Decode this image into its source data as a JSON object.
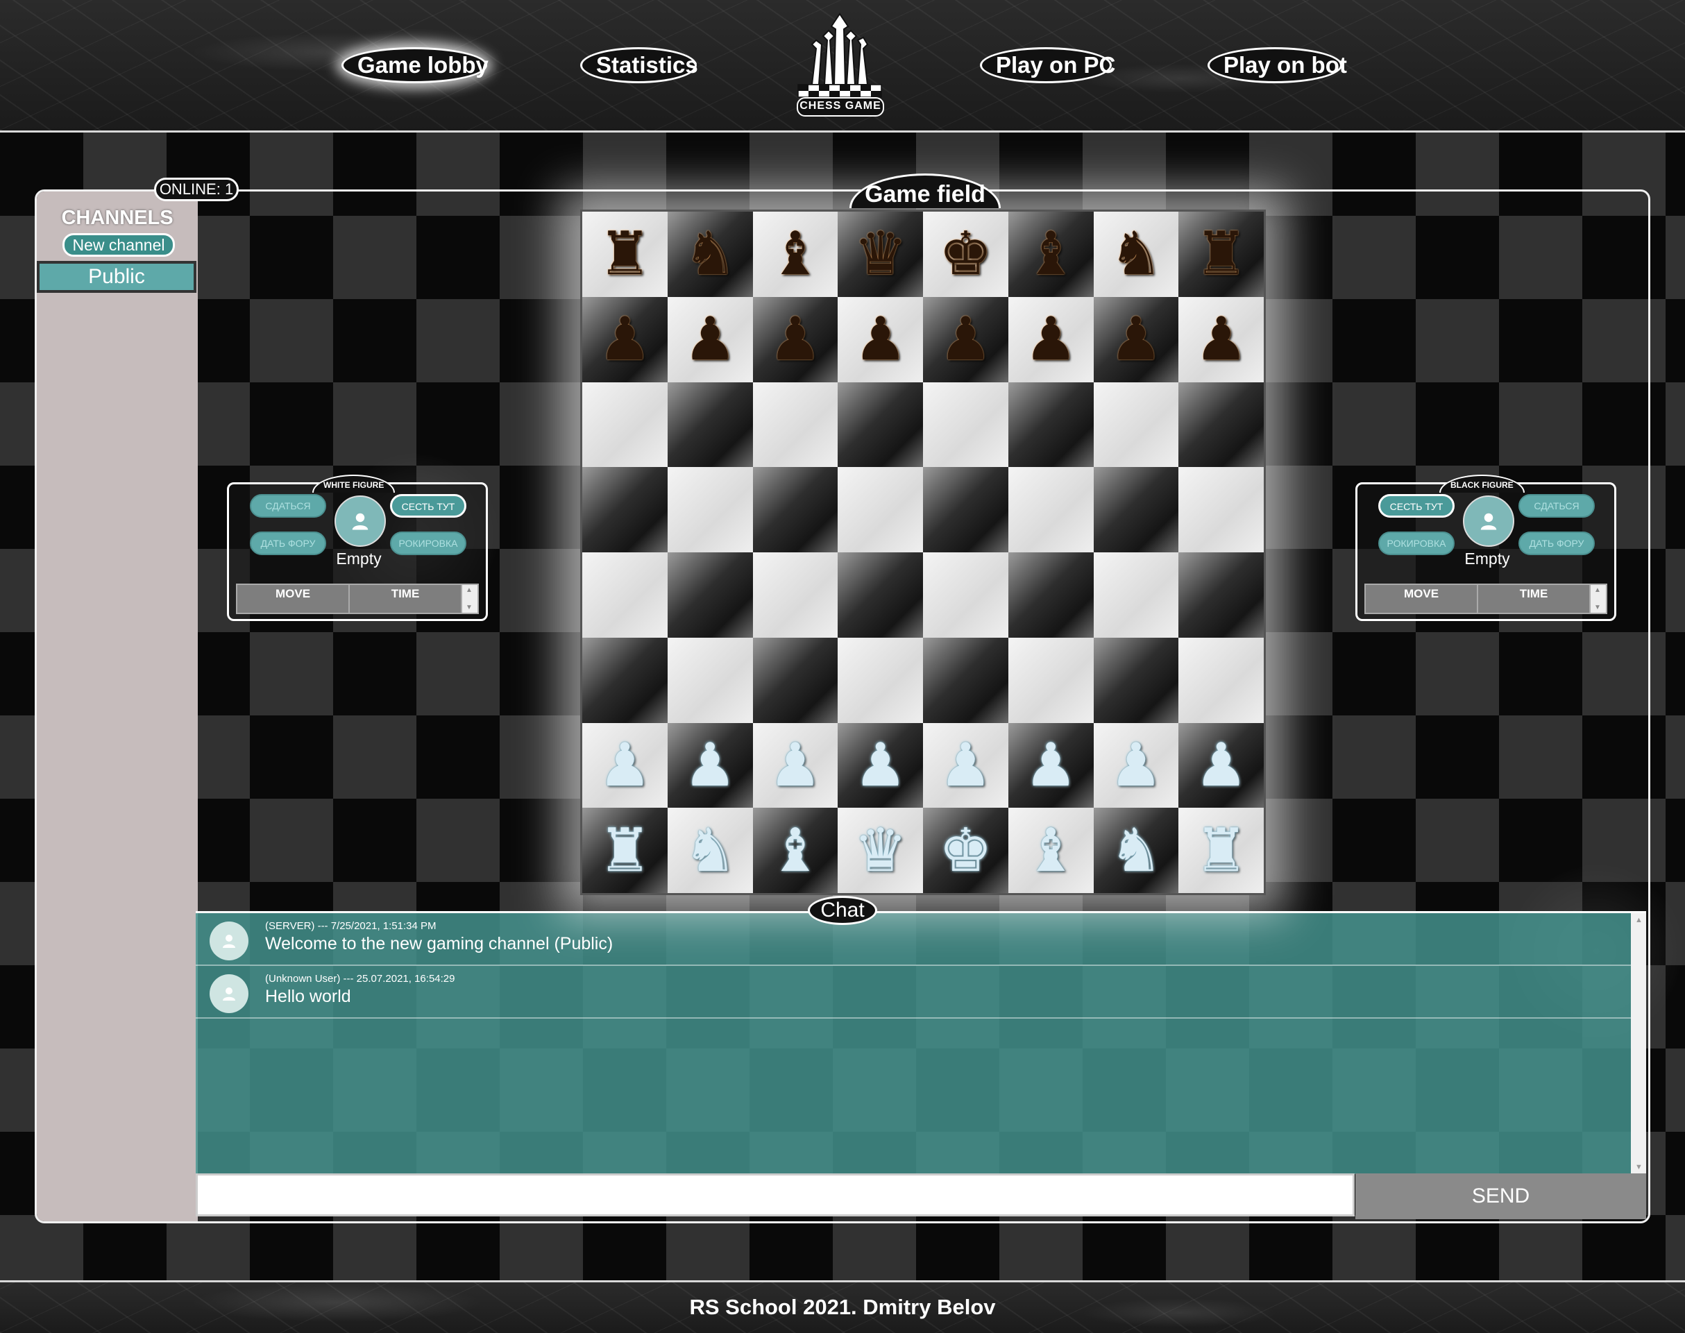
{
  "nav": {
    "items": [
      "Game lobby",
      "Statistics",
      "Play on PC",
      "Play on bot"
    ],
    "active": "Game lobby",
    "logo_text": "CHESS GAME"
  },
  "sidebar": {
    "online": "ONLINE: 1",
    "title": "CHANNELS",
    "new_channel": "New channel",
    "channels": [
      "Public"
    ]
  },
  "game_field": {
    "title": "Game field",
    "board": [
      [
        "r",
        "n",
        "b",
        "q",
        "k",
        "b",
        "n",
        "r"
      ],
      [
        "p",
        "p",
        "p",
        "p",
        "p",
        "p",
        "p",
        "p"
      ],
      [
        "",
        "",
        "",
        "",
        "",
        "",
        "",
        ""
      ],
      [
        "",
        "",
        "",
        "",
        "",
        "",
        "",
        ""
      ],
      [
        "",
        "",
        "",
        "",
        "",
        "",
        "",
        ""
      ],
      [
        "",
        "",
        "",
        "",
        "",
        "",
        "",
        ""
      ],
      [
        "P",
        "P",
        "P",
        "P",
        "P",
        "P",
        "P",
        "P"
      ],
      [
        "R",
        "N",
        "B",
        "Q",
        "K",
        "B",
        "N",
        "R"
      ]
    ]
  },
  "white_panel": {
    "label": "WHITE FIGURE",
    "surrender": "СДАТЬСЯ",
    "sit_here": "СЕСТЬ ТУТ",
    "give_odds": "ДАТЬ ФОРУ",
    "castling": "РОКИРОВКА",
    "player": "Empty",
    "col_move": "MOVE",
    "col_time": "TIME"
  },
  "black_panel": {
    "label": "BLACK FIGURE",
    "surrender": "СДАТЬСЯ",
    "sit_here": "СЕСТЬ ТУТ",
    "give_odds": "ДАТЬ ФОРУ",
    "castling": "РОКИРОВКА",
    "player": "Empty",
    "col_move": "MOVE",
    "col_time": "TIME"
  },
  "chat": {
    "title": "Chat",
    "messages": [
      {
        "meta": "(SERVER) --- 7/25/2021, 1:51:34 PM",
        "text": "Welcome to the new gaming channel (Public)"
      },
      {
        "meta": "(Unknown User) --- 25.07.2021, 16:54:29",
        "text": "Hello world"
      }
    ],
    "input_value": "",
    "send": "SEND"
  },
  "footer": {
    "text": "RS School 2021. Dmitry Belov"
  },
  "colors": {
    "accent": "#5ea9a9",
    "chat_bg": "#469691",
    "sidebar_bg": "#c6bcbc"
  }
}
